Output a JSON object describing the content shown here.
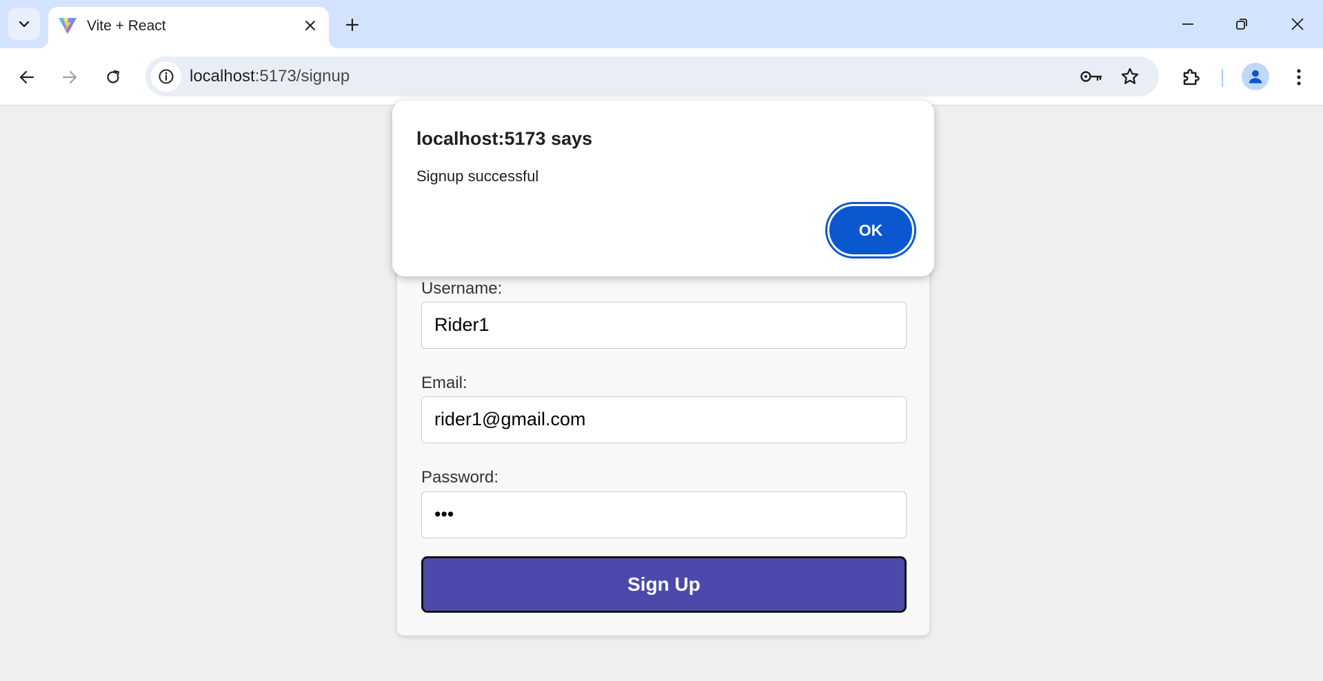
{
  "browser": {
    "tab": {
      "title": "Vite + React",
      "favicon": "vite-logo-icon"
    },
    "omnibox": {
      "host": "localhost",
      "path": ":5173/signup"
    },
    "icons": {
      "tab_search": "chevron-down-icon",
      "tab_close": "close-icon",
      "new_tab": "plus-icon",
      "minimize": "minimize-icon",
      "restore": "restore-icon",
      "close_window": "close-icon",
      "back": "arrow-left-icon",
      "forward": "arrow-right-icon",
      "reload": "reload-icon",
      "site_info": "info-icon",
      "passwords": "key-icon",
      "bookmark": "star-icon",
      "extensions": "puzzle-icon",
      "profile": "person-icon",
      "menu": "kebab-menu-icon"
    },
    "colors": {
      "tabstrip": "#d3e3fd",
      "omnibox": "#e9eef6",
      "accent": "#0b57d0"
    }
  },
  "form": {
    "username": {
      "label": "Username:",
      "value": "Rider1"
    },
    "email": {
      "label": "Email:",
      "value": "rider1@gmail.com"
    },
    "password": {
      "label": "Password:",
      "value": "•••"
    },
    "submit_label": "Sign Up",
    "colors": {
      "button": "#4b4aab"
    }
  },
  "dialog": {
    "title": "localhost:5173 says",
    "message": "Signup successful",
    "ok_label": "OK"
  }
}
